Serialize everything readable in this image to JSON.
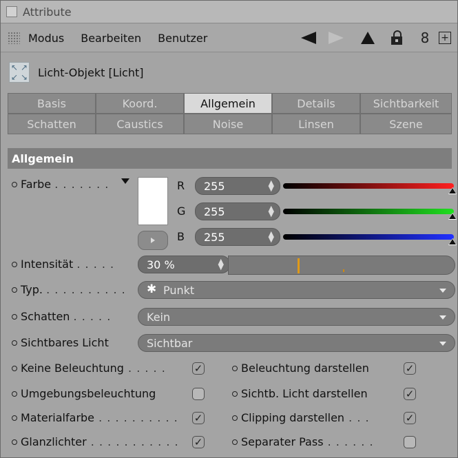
{
  "window": {
    "title": "Attribute"
  },
  "menu": {
    "items": [
      "Modus",
      "Bearbeiten",
      "Benutzer"
    ]
  },
  "object": {
    "name": "Licht-Objekt [Licht]"
  },
  "tabs": {
    "row1": [
      "Basis",
      "Koord.",
      "Allgemein",
      "Details",
      "Sichtbarkeit"
    ],
    "row2": [
      "Schatten",
      "Caustics",
      "Noise",
      "Linsen",
      "Szene"
    ],
    "active": "Allgemein"
  },
  "section": {
    "title": "Allgemein"
  },
  "farbe": {
    "label": "Farbe",
    "leader": ". . . . . . .",
    "swatch_color": "#ffffff",
    "channels": [
      {
        "name": "R",
        "value": "255",
        "track_color": "#ff2020"
      },
      {
        "name": "G",
        "value": "255",
        "track_color": "#20e020"
      },
      {
        "name": "B",
        "value": "255",
        "track_color": "#2030ff"
      }
    ]
  },
  "intensitaet": {
    "label": "Intensität",
    "leader": ". . . . .",
    "value": "30 %",
    "marker_fraction": 0.3
  },
  "typ": {
    "label": "Typ.",
    "leader": ". . . . . . . . . .",
    "value": "Punkt"
  },
  "schatten": {
    "label": "Schatten",
    "leader": ". . . . .",
    "value": "Kein"
  },
  "sichtbares_licht": {
    "label": "Sichtbares Licht",
    "value": "Sichtbar"
  },
  "checkboxes": {
    "left": [
      {
        "label": "Keine Beleuchtung",
        "leader": ". . . . .",
        "checked": true
      },
      {
        "label": "Umgebungsbeleuchtung",
        "leader": "",
        "checked": false
      },
      {
        "label": "Materialfarbe",
        "leader": ". . . . . . . . . .",
        "checked": true
      },
      {
        "label": "Glanzlichter",
        "leader": ". . . . . . . . . . .",
        "checked": true
      }
    ],
    "right": [
      {
        "label": "Beleuchtung darstellen",
        "leader": "",
        "checked": true
      },
      {
        "label": "Sichtb. Licht darstellen",
        "leader": "",
        "checked": true
      },
      {
        "label": "Clipping darstellen",
        "leader": ". . .",
        "checked": true
      },
      {
        "label": "Separater Pass",
        "leader": ". . . . . .",
        "checked": false
      }
    ]
  },
  "icons": {
    "title_checkbox": "checkbox-icon",
    "grip": "grip-icon",
    "back": "arrow-left-icon",
    "forward": "arrow-right-icon",
    "up": "arrow-up-icon",
    "lock": "lock-icon",
    "link": "link-icon",
    "new_panel": "add-panel-icon",
    "light": "light-object-icon"
  },
  "check_mark": "✓"
}
